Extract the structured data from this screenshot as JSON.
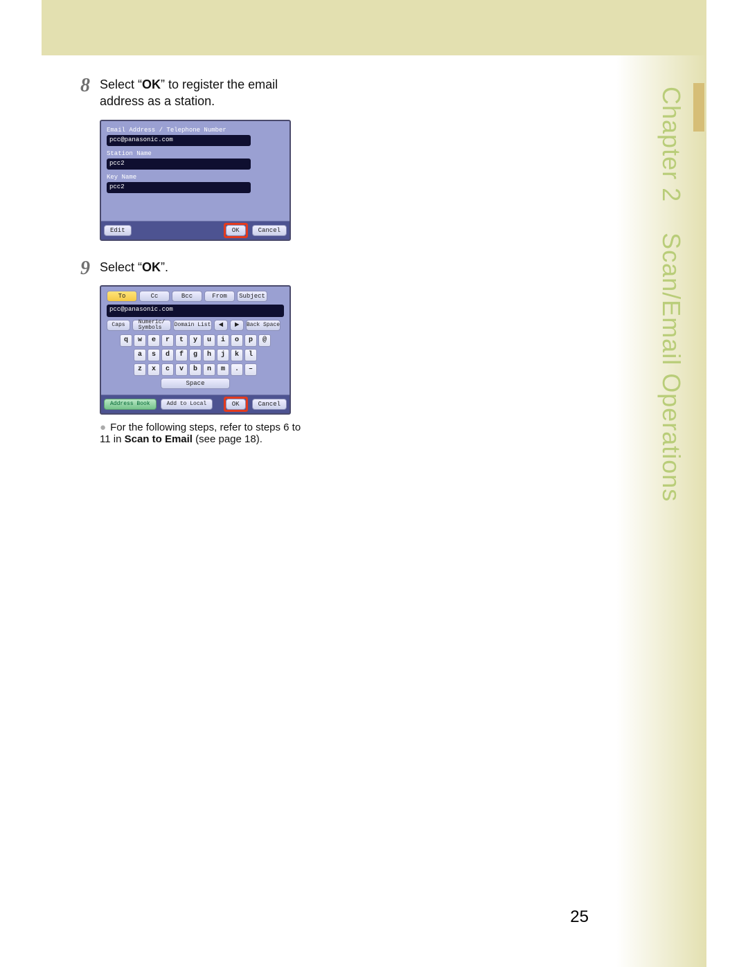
{
  "sidebar": {
    "chapter_label": "Chapter 2",
    "section_label": "Scan/Email Operations"
  },
  "page_number": "25",
  "step8": {
    "num": "8",
    "text_before": "Select “",
    "ok": "OK",
    "text_after": "” to register the email address as a station.",
    "screen": {
      "lbl_email": "Email Address / Telephone Number",
      "val_email": "pcc@panasonic.com",
      "lbl_station": "Station Name",
      "val_station": "pcc2",
      "lbl_key": "Key Name",
      "val_key": "pcc2",
      "btn_edit": "Edit",
      "btn_ok": "OK",
      "btn_cancel": "Cancel"
    }
  },
  "step9": {
    "num": "9",
    "text_before": "Select “",
    "ok": "OK",
    "text_after": "”.",
    "screen": {
      "tab_to": "To",
      "tab_cc": "Cc",
      "tab_bcc": "Bcc",
      "tab_from": "From",
      "tab_subject": "Subject",
      "addr_val": "pcc@panasonic.com",
      "btn_caps": "Caps",
      "btn_numsym": "Numeric/\nSymbols",
      "btn_domain": "Domain List",
      "arrow_left": "◄",
      "arrow_right": "►",
      "btn_backspace": "Back Space",
      "row1": [
        "q",
        "w",
        "e",
        "r",
        "t",
        "y",
        "u",
        "i",
        "o",
        "p",
        "@"
      ],
      "row2": [
        "a",
        "s",
        "d",
        "f",
        "g",
        "h",
        "j",
        "k",
        "l"
      ],
      "row3": [
        "z",
        "x",
        "c",
        "v",
        "b",
        "n",
        "m",
        ".",
        "–"
      ],
      "btn_space": "Space",
      "btn_addrbook": "Address Book",
      "btn_addlocal": "Add to Local",
      "btn_ok": "OK",
      "btn_cancel": "Cancel"
    },
    "note_prefix": "For the following steps, refer to steps 6 to 11 in ",
    "note_bold": "Scan to Email",
    "note_suffix": " (see page 18)."
  }
}
